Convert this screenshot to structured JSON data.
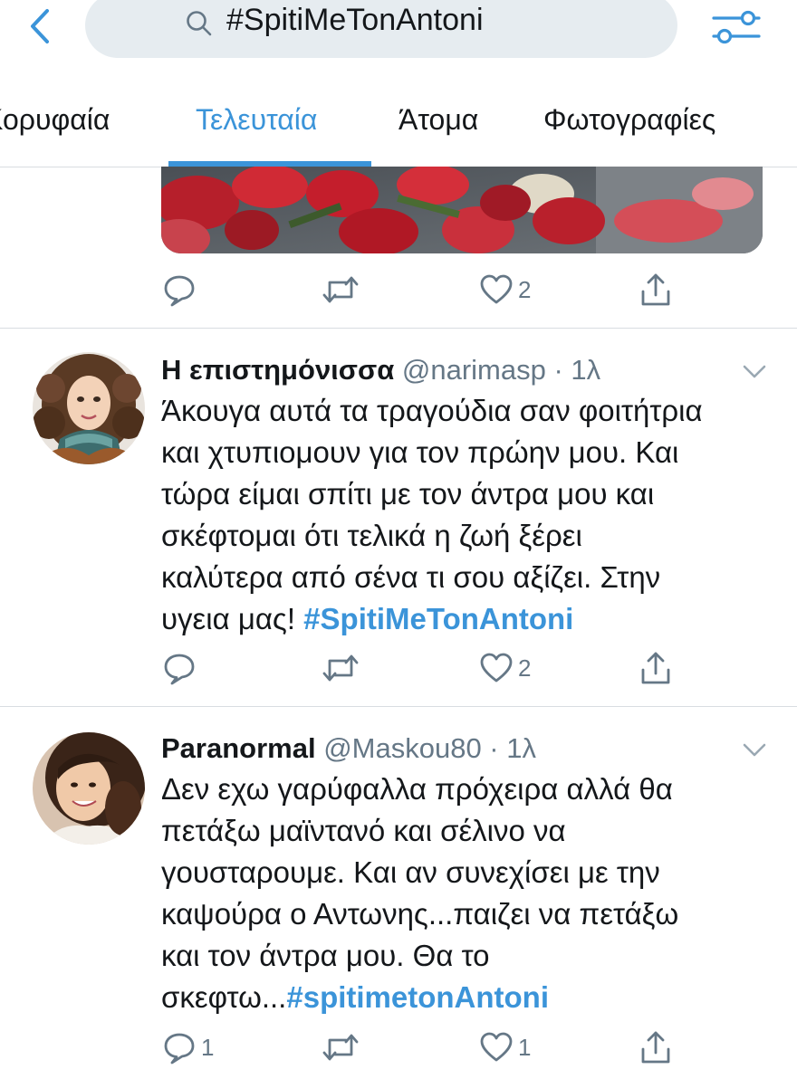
{
  "header": {
    "search_query": "#SpitiMeTonAntoni"
  },
  "tabs": [
    {
      "label": "Κορυφαία",
      "active": false
    },
    {
      "label": "Τελευταία",
      "active": true
    },
    {
      "label": "Άτομα",
      "active": false
    },
    {
      "label": "Φωτογραφίες",
      "active": false
    }
  ],
  "top_tweet": {
    "actions": {
      "reply": "",
      "retweet": "",
      "like": "2"
    }
  },
  "tweets": [
    {
      "name": "Η επιστημόνισσα",
      "meta": " @narimasp · 1λ",
      "lines": [
        "Άκουγα αυτά τα τραγούδια σαν φοιτήτρια",
        "και χτυπιομουν για τον πρώην μου. Και",
        "τώρα είμαι σπίτι με τον άντρα μου και",
        "σκέφτομαι ότι τελικά η ζωή ξέρει",
        "καλύτερα από σένα τι σου αξίζει. Στην",
        "υγεια μας! "
      ],
      "hashtag": "#SpitiMeTonAntoni",
      "actions": {
        "reply": "",
        "retweet": "",
        "like": "2"
      }
    },
    {
      "name": "Paranormal",
      "meta": " @Maskou80 · 1λ",
      "lines": [
        "Δεν εχω γαρύφαλλα πρόχειρα αλλά θα",
        "πετάξω μαϊντανό και σέλινο να",
        "γουσταρουμε. Και αν συνεχίσει με την",
        "καψούρα ο Αντωνης...παιζει να πετάξω",
        "και τον άντρα μου. Θα το",
        "σκεφτω..."
      ],
      "hashtag": "#spitimetonAntoni",
      "actions": {
        "reply": "1",
        "retweet": "",
        "like": "1"
      }
    }
  ],
  "colors": {
    "accent": "#3b94d9",
    "secondary_text": "#657786",
    "search_bg": "#e6ecf0"
  }
}
